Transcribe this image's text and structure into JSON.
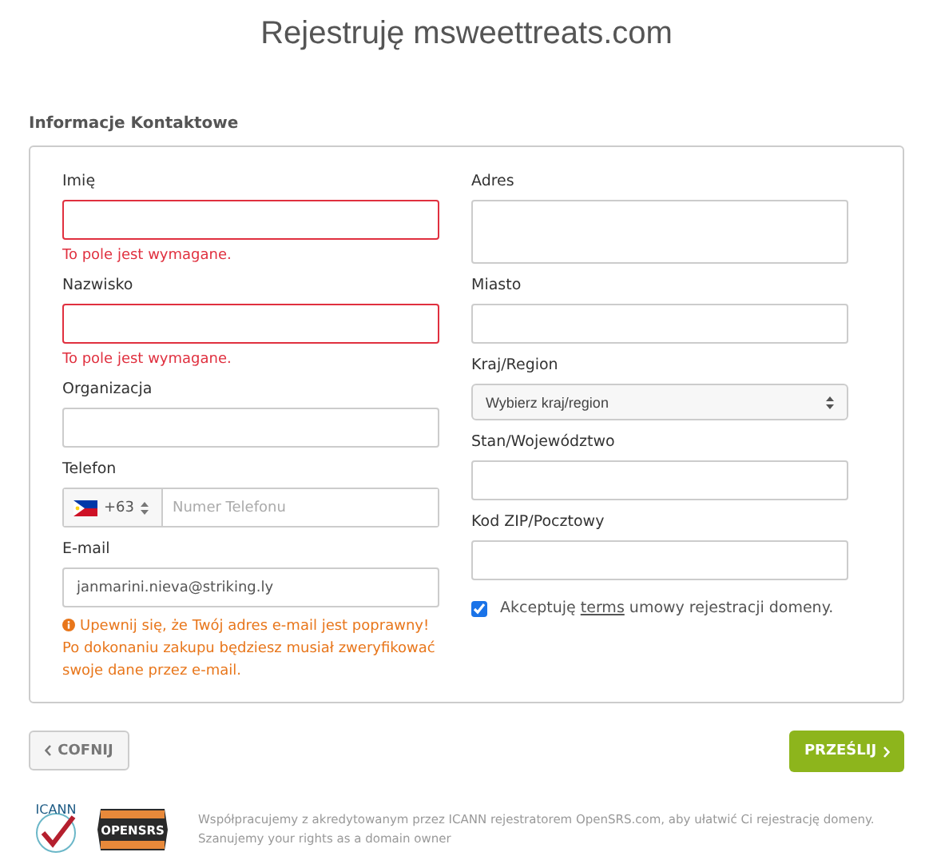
{
  "title": "Rejestruję msweettreats.com",
  "section": "Informacje Kontaktowe",
  "left": [
    {
      "kind": "text",
      "label": "Imię",
      "invalid": true,
      "error": "To pole jest wymagane."
    },
    {
      "kind": "text",
      "label": "Nazwisko",
      "invalid": true,
      "error": "To pole jest wymagane."
    },
    {
      "kind": "text",
      "label": "Organizacja",
      "invalid": false
    },
    {
      "kind": "phone",
      "label": "Telefon",
      "code": "+63",
      "placeholder": "Numer Telefonu",
      "invalid": false
    },
    {
      "kind": "text",
      "label": "E-mail",
      "value": "janmarini.nieva@striking.ly",
      "invalid": false,
      "warning": "Upewnij się, że Twój adres e-mail jest poprawny! Po dokonaniu zakupu będziesz musiał zweryfikować swoje dane przez e-mail."
    }
  ],
  "right": [
    {
      "kind": "textarea",
      "label": "Adres",
      "invalid": false
    },
    {
      "kind": "text",
      "label": "Miasto",
      "invalid": false
    },
    {
      "kind": "select",
      "label": "Kraj/Region",
      "value": "Wybierz kraj/region",
      "invalid": false
    },
    {
      "kind": "text",
      "label": "Stan/Województwo",
      "invalid": false
    },
    {
      "kind": "text",
      "label": "Kod ZIP/Pocztowy",
      "invalid": false
    }
  ],
  "agreement": {
    "checked": true,
    "before": "Akceptuję",
    "link": "terms",
    "after": "umowy rejestracji domeny."
  },
  "back_button": "COFNIJ",
  "submit_button": "PRZEŚLIJ",
  "logos": {
    "icann": "ICANN",
    "opensrs": "OPENSRS"
  },
  "footer": [
    "Współpracujemy z akredytowanym przez ICANN rejestratorem OpenSRS.com, aby ułatwić Ci rejestrację domeny.",
    "Szanujemy your rights as a domain owner"
  ]
}
